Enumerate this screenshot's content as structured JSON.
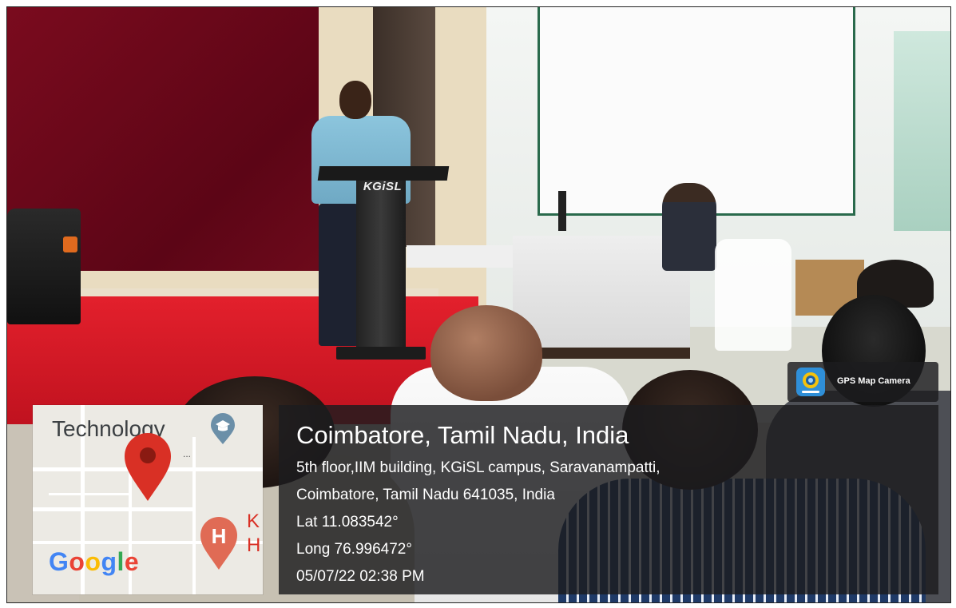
{
  "photo": {
    "podium_logo": "KGiSL"
  },
  "map": {
    "label_top": "Technology",
    "label_dots": "...",
    "label_right_1": "K",
    "label_right_2": "H",
    "marker_letter": "H",
    "google_logo": "Google"
  },
  "location": {
    "title": "Coimbatore, Tamil Nadu, India",
    "address_line1": "5th floor,IIM building, KGiSL campus, Saravanampatti,",
    "address_line2": "Coimbatore, Tamil Nadu 641035, India",
    "latitude": "Lat 11.083542°",
    "longitude": "Long 76.996472°",
    "datetime": "05/07/22 02:38 PM"
  },
  "app_badge": {
    "label": "GPS Map Camera"
  },
  "colors": {
    "pin_red": "#d93025",
    "school_marker": "#6b8fa8",
    "google_blue": "#4285f4",
    "google_red": "#ea4335",
    "google_yellow": "#fbbc05",
    "google_green": "#34a853"
  }
}
